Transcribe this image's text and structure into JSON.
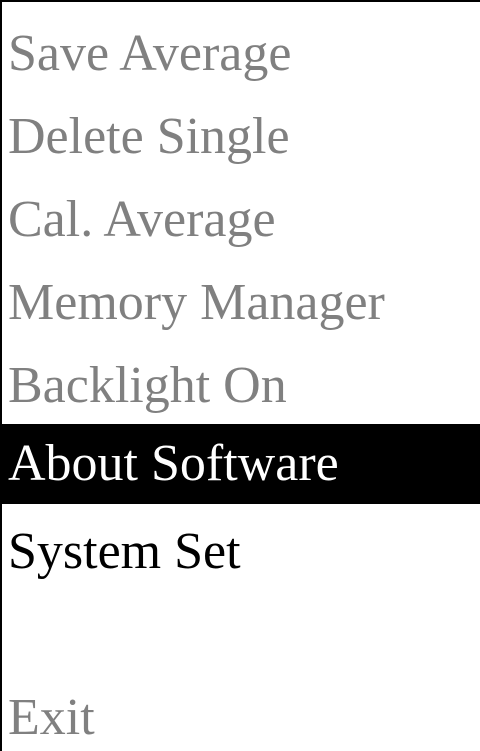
{
  "menu": {
    "items": [
      {
        "label": "Save Average",
        "state": "disabled"
      },
      {
        "label": "Delete Single",
        "state": "disabled"
      },
      {
        "label": "Cal. Average",
        "state": "disabled"
      },
      {
        "label": "Memory Manager",
        "state": "disabled"
      },
      {
        "label": "Backlight On",
        "state": "disabled"
      },
      {
        "label": "About Software",
        "state": "selected"
      },
      {
        "label": "System Set",
        "state": "enabled"
      },
      {
        "label": "Exit",
        "state": "disabled"
      }
    ]
  },
  "colors": {
    "disabled_text": "#808080",
    "enabled_text": "#000000",
    "selected_background": "#000000",
    "selected_text": "#ffffff",
    "border": "#000000",
    "background": "#ffffff"
  }
}
